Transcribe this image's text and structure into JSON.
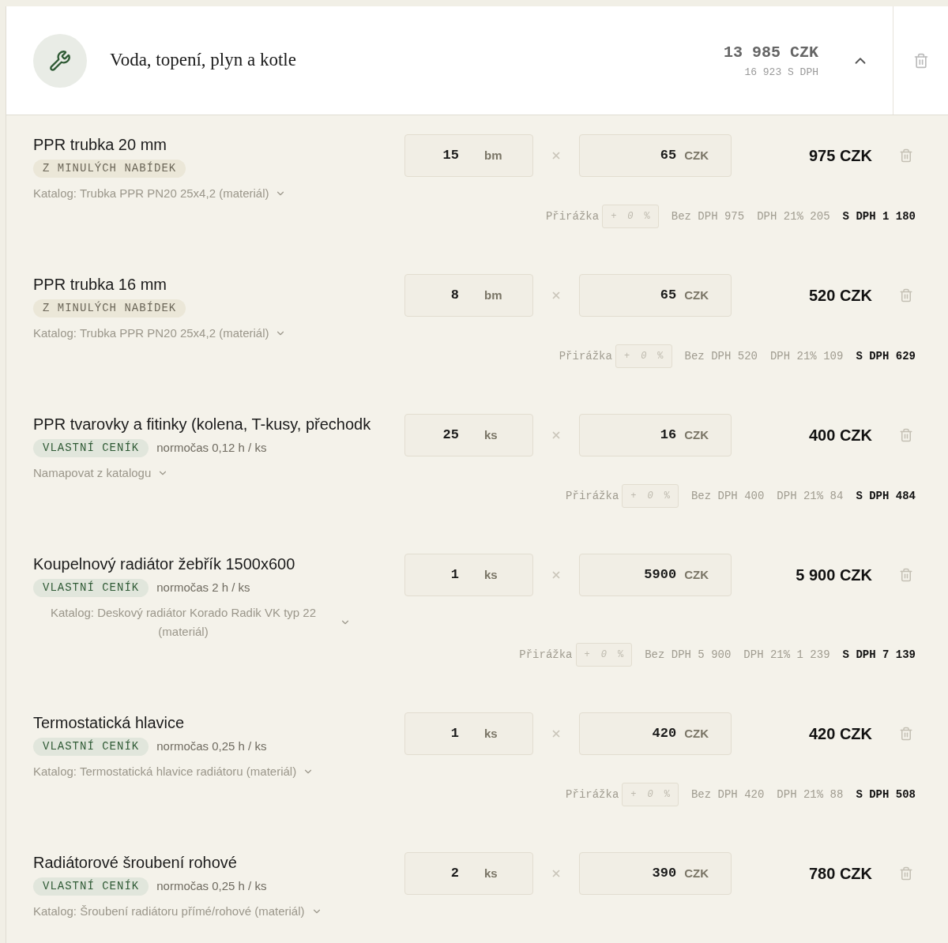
{
  "section": {
    "title": "Voda, topení, plyn a kotle",
    "total": "13 985 CZK",
    "total_vat": "16 923 S DPH",
    "expanded": true
  },
  "items": [
    {
      "name": "PPR trubka 20 mm",
      "tag": {
        "kind": "past",
        "label": "Z MINULÝCH NABÍDEK"
      },
      "catalog": "Katalog: Trubka PPR PN20 25x4,2 (materiál)",
      "qty": "15",
      "unit": "bm",
      "price": "65",
      "currency": "CZK",
      "total": "975 CZK",
      "markup": {
        "label": "Přirážka",
        "sign": "+",
        "value": "0",
        "suffix": "%"
      },
      "net": "Bez DPH 975",
      "vat": "DPH 21% 205",
      "gross": "S DPH 1 180"
    },
    {
      "name": "PPR trubka 16 mm",
      "tag": {
        "kind": "past",
        "label": "Z MINULÝCH NABÍDEK"
      },
      "catalog": "Katalog: Trubka PPR PN20 25x4,2 (materiál)",
      "qty": "8",
      "unit": "bm",
      "price": "65",
      "currency": "CZK",
      "total": "520 CZK",
      "markup": {
        "label": "Přirážka",
        "sign": "+",
        "value": "0",
        "suffix": "%"
      },
      "net": "Bez DPH 520",
      "vat": "DPH 21% 109",
      "gross": "S DPH 629"
    },
    {
      "name": "PPR tvarovky a fitinky (kolena, T-kusy, přechodk",
      "tag": {
        "kind": "own",
        "label": "VLASTNÍ CENÍK"
      },
      "norm": "normočas 0,12 h / ks",
      "catalog": "Namapovat z katalogu",
      "qty": "25",
      "unit": "ks",
      "price": "16",
      "currency": "CZK",
      "total": "400 CZK",
      "markup": {
        "label": "Přirážka",
        "sign": "+",
        "value": "0",
        "suffix": "%"
      },
      "net": "Bez DPH 400",
      "vat": "DPH 21% 84",
      "gross": "S DPH 484"
    },
    {
      "name": "Koupelnový radiátor žebřík 1500x600",
      "tag": {
        "kind": "own",
        "label": "VLASTNÍ CENÍK"
      },
      "norm": "normočas 2 h / ks",
      "catalog": "Katalog: Deskový radiátor Korado Radik VK typ 22 (materiál)",
      "qty": "1",
      "unit": "ks",
      "price": "5900",
      "currency": "CZK",
      "total": "5 900 CZK",
      "markup": {
        "label": "Přirážka",
        "sign": "+",
        "value": "0",
        "suffix": "%"
      },
      "net": "Bez DPH 5 900",
      "vat": "DPH 21% 1 239",
      "gross": "S DPH 7 139"
    },
    {
      "name": "Termostatická hlavice",
      "tag": {
        "kind": "own",
        "label": "VLASTNÍ CENÍK"
      },
      "norm": "normočas 0,25 h / ks",
      "catalog": "Katalog: Termostatická hlavice radiátoru (materiál)",
      "qty": "1",
      "unit": "ks",
      "price": "420",
      "currency": "CZK",
      "total": "420 CZK",
      "markup": {
        "label": "Přirážka",
        "sign": "+",
        "value": "0",
        "suffix": "%"
      },
      "net": "Bez DPH 420",
      "vat": "DPH 21% 88",
      "gross": "S DPH 508"
    },
    {
      "name": "Radiátorové šroubení rohové",
      "tag": {
        "kind": "own",
        "label": "VLASTNÍ CENÍK"
      },
      "norm": "normočas 0,25 h / ks",
      "catalog": "Katalog: Šroubení radiátoru přímé/rohové (materiál)",
      "qty": "2",
      "unit": "ks",
      "price": "390",
      "currency": "CZK",
      "total": "780 CZK"
    }
  ]
}
